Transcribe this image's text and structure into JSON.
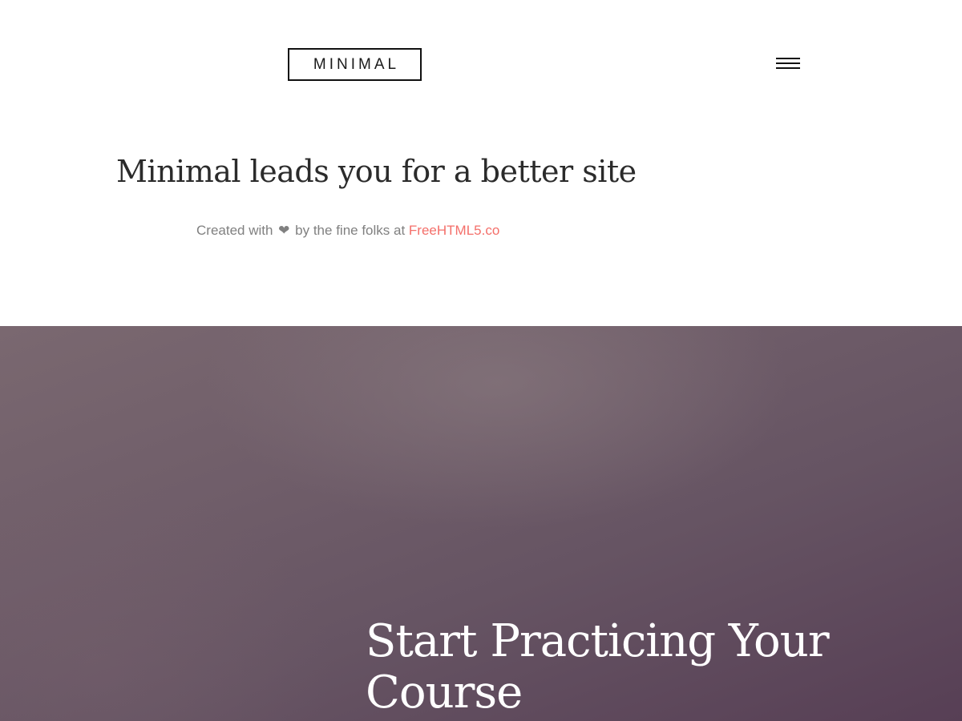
{
  "header": {
    "logo_text": "MINIMAL",
    "menu_icon": "hamburger-menu-icon"
  },
  "hero": {
    "title": "Minimal leads you for a better site",
    "credit_prefix": "Created with",
    "credit_heart_icon": "heart-icon",
    "credit_middle": "by the fine folks at",
    "credit_link": "FreeHTML5.co"
  },
  "feature": {
    "title": "Start Practicing Your Course"
  },
  "colors": {
    "accent": "#f46f6a",
    "text_dark": "#2b2b2b",
    "text_muted": "#808080",
    "feature_bg": "#6b5867"
  }
}
